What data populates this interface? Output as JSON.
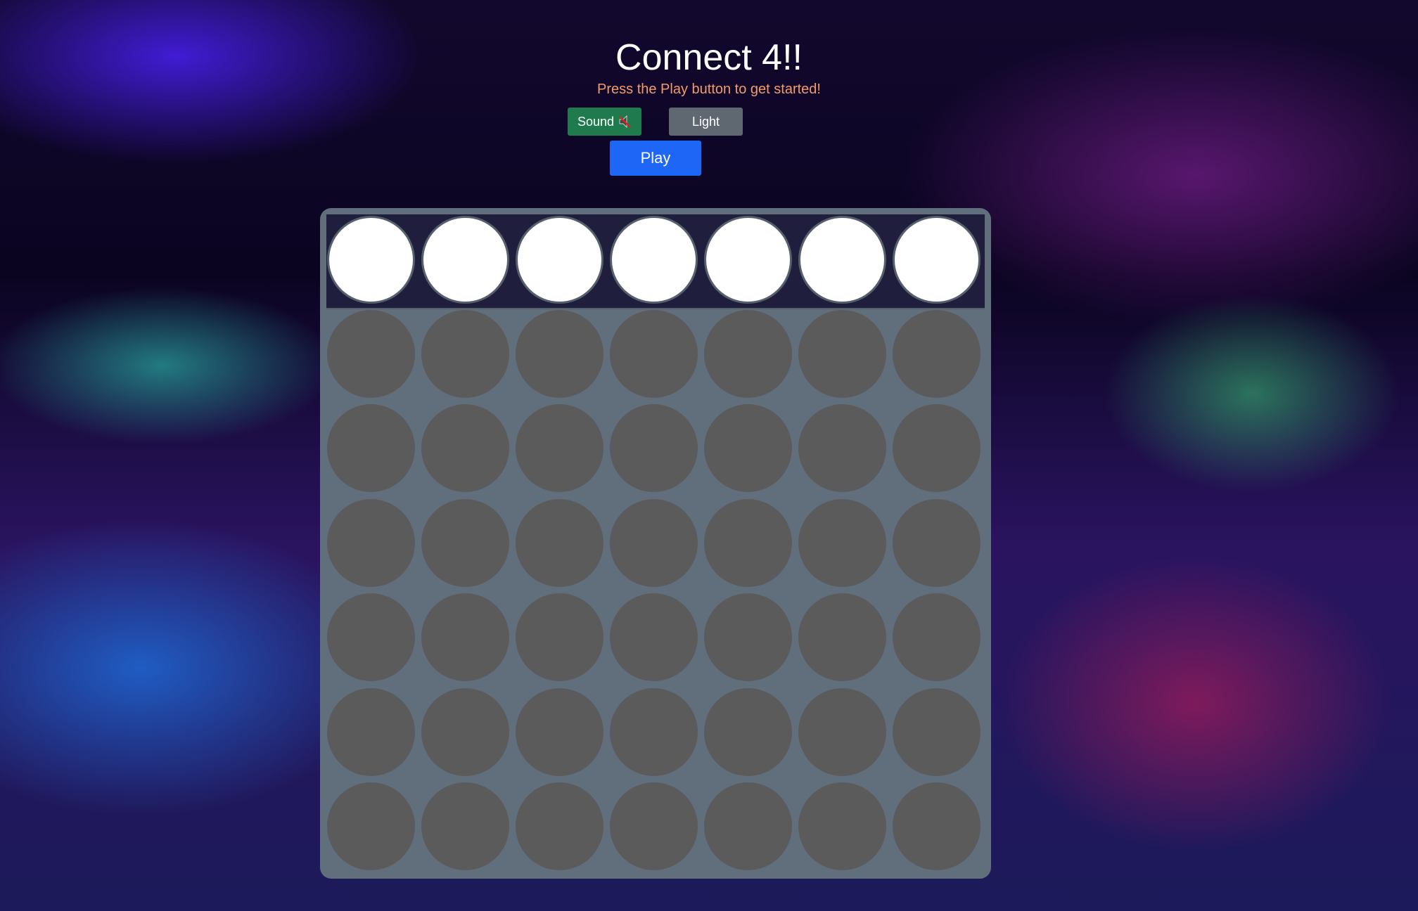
{
  "header": {
    "title": "Connect 4!!",
    "subtitle": "Press the Play button to get started!"
  },
  "controls": {
    "sound_label": "Sound",
    "sound_icon": "speaker-muted-icon",
    "light_label": "Light",
    "play_label": "Play"
  },
  "colors": {
    "sound_button": "#1f7a4d",
    "light_button": "#5f6870",
    "play_button": "#1e66f5",
    "board": "#616e7c",
    "empty_slot": "#5b5b5b",
    "drop_slot": "#ffffff",
    "subtitle": "#f39a6e"
  },
  "board": {
    "columns": 7,
    "rows": 6,
    "cells": "all empty"
  }
}
